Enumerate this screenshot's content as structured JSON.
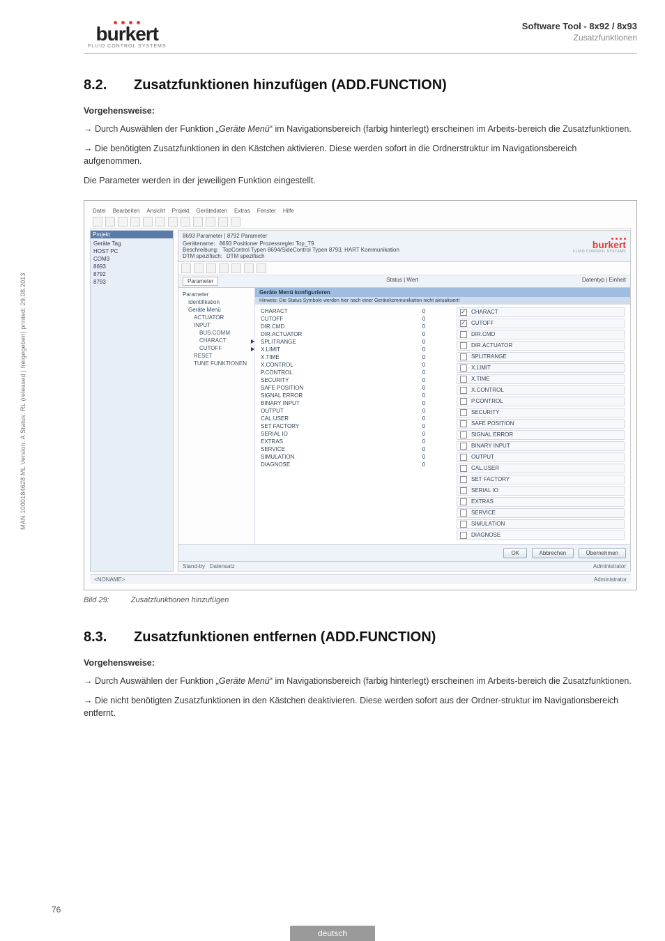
{
  "header": {
    "logo_text": "burkert",
    "logo_sub": "FLUID CONTROL SYSTEMS",
    "title": "Software Tool - 8x92 / 8x93",
    "subtitle": "Zusatzfunktionen"
  },
  "section_8_2": {
    "num": "8.2.",
    "title": "Zusatzfunktionen hinzufügen (ADD.FUNCTION)",
    "vorgehensweise": "Vorgehensweise:",
    "p1_a": "→ Durch Auswählen der Funktion „",
    "p1_em": "Geräte Menü",
    "p1_b": "“ im Navigationsbereich (farbig hinterlegt) erscheinen im Arbeits-bereich die Zusatzfunktionen.",
    "p2": "→ Die benötigten Zusatzfunktionen in den Kästchen aktivieren. Diese werden sofort in die Ordnerstruktur im Navigationsbereich aufgenommen.",
    "p3": "Die Parameter werden in der jeweiligen Funktion eingestellt."
  },
  "screenshot": {
    "menubar": [
      "Datei",
      "Bearbeiten",
      "Ansicht",
      "Projekt",
      "Gerätedaten",
      "Extras",
      "Fenster",
      "Hilfe"
    ],
    "nav": {
      "head": "Projekt",
      "items": [
        "Geräte Tag",
        "HOST PC",
        "COM3",
        "8693",
        "8792",
        "8793"
      ]
    },
    "workhead": {
      "tab": "8693 Parameter  |  8792 Parameter",
      "geraet_lbl": "Gerätename:",
      "geraet_val": "8693 Positioner Prozessregler Top_T9",
      "besch_lbl": "Beschreibung:",
      "besch_val": "TopControl Typen 8694/SideControl Typen 8793, HART Kommunikation",
      "dtm_lbl": "DTM spezifisch:",
      "dtm_val": "DTM spezifisch"
    },
    "inner_logo": "burkert",
    "inner_logo_sub": "FLUID CONTROL SYSTEMS",
    "param_tab": "Parameter",
    "status_lbl": "Status  | Wert",
    "right_lbl": "Datentyp  | Einheit",
    "gm_title": "Geräte Menü konfigurieren",
    "gm_note": "Hinweis: Die Status Symbole werden hier nach einer Gerätekommunikation nicht aktualisiert!",
    "tree": [
      {
        "label": "Parameter",
        "indent": 0
      },
      {
        "label": "Identifikation",
        "indent": 1
      },
      {
        "label": "Geräte Menü",
        "indent": 1,
        "sel": true
      },
      {
        "label": "ACTUATOR",
        "indent": 2
      },
      {
        "label": "INPUT",
        "indent": 2
      },
      {
        "label": "BUS.COMM",
        "indent": 3
      },
      {
        "label": "CHARACT",
        "indent": 3,
        "arrow": true
      },
      {
        "label": "CUTOFF",
        "indent": 3,
        "arrow": true
      },
      {
        "label": "RESET",
        "indent": 2
      },
      {
        "label": "TUNE FUNKTIONEN",
        "indent": 2
      }
    ],
    "func_left": [
      {
        "name": "CHARACT",
        "v": "0"
      },
      {
        "name": "CUTOFF",
        "v": "0"
      },
      {
        "name": "DIR.CMD",
        "v": "0"
      },
      {
        "name": "DIR.ACTUATOR",
        "v": "0"
      },
      {
        "name": "SPLITRANGE",
        "v": "0"
      },
      {
        "name": "X.LIMIT",
        "v": "0"
      },
      {
        "name": "X.TIME",
        "v": "0"
      },
      {
        "name": "X.CONTROL",
        "v": "0"
      },
      {
        "name": "P.CONTROL",
        "v": "0"
      },
      {
        "name": "SECURITY",
        "v": "0"
      },
      {
        "name": "SAFE POSITION",
        "v": "0"
      },
      {
        "name": "SIGNAL ERROR",
        "v": "0"
      },
      {
        "name": "BINARY INPUT",
        "v": "0"
      },
      {
        "name": "OUTPUT",
        "v": "0"
      },
      {
        "name": "CAL.USER",
        "v": "0"
      },
      {
        "name": "SET FACTORY",
        "v": "0"
      },
      {
        "name": "SERIAL IO",
        "v": "0"
      },
      {
        "name": "EXTRAS",
        "v": "0"
      },
      {
        "name": "SERVICE",
        "v": "0"
      },
      {
        "name": "SIMULATION",
        "v": "0"
      },
      {
        "name": "DIAGNOSE",
        "v": "0"
      }
    ],
    "func_right": [
      {
        "name": "CHARACT",
        "chk": true
      },
      {
        "name": "CUTOFF",
        "chk": true
      },
      {
        "name": "DIR.CMD",
        "chk": false
      },
      {
        "name": "DIR.ACTUATOR",
        "chk": false
      },
      {
        "name": "SPLITRANGE",
        "chk": false
      },
      {
        "name": "X.LIMIT",
        "chk": false
      },
      {
        "name": "X.TIME",
        "chk": false
      },
      {
        "name": "X.CONTROL",
        "chk": false
      },
      {
        "name": "P.CONTROL",
        "chk": false
      },
      {
        "name": "SECURITY",
        "chk": false
      },
      {
        "name": "SAFE POSITION",
        "chk": false
      },
      {
        "name": "SIGNAL ERROR",
        "chk": false
      },
      {
        "name": "BINARY INPUT",
        "chk": false
      },
      {
        "name": "OUTPUT",
        "chk": false
      },
      {
        "name": "CAL.USER",
        "chk": false
      },
      {
        "name": "SET FACTORY",
        "chk": false
      },
      {
        "name": "SERIAL IO",
        "chk": false
      },
      {
        "name": "EXTRAS",
        "chk": false
      },
      {
        "name": "SERVICE",
        "chk": false
      },
      {
        "name": "SIMULATION",
        "chk": false
      },
      {
        "name": "DIAGNOSE",
        "chk": false
      }
    ],
    "buttons": {
      "ok": "OK",
      "cancel": "Abbrechen",
      "apply": "Übernehmen"
    },
    "status_left_a": "Stand-by",
    "status_left_b": "Datensatz",
    "status_mid": "Administrator",
    "status_bottom_left": "<NONAME>",
    "status_bottom_right": "Administrator"
  },
  "figcaption": {
    "label": "Bild 29:",
    "text": "Zusatzfunktionen hinzufügen"
  },
  "section_8_3": {
    "num": "8.3.",
    "title": "Zusatzfunktionen entfernen (ADD.FUNCTION)",
    "vorgehensweise": "Vorgehensweise:",
    "p1_a": "→ Durch Auswählen der Funktion „",
    "p1_em": "Geräte Menü",
    "p1_b": "“ im Navigationsbereich (farbig hinterlegt) erscheinen im Arbeits-bereich die Zusatzfunktionen.",
    "p2": "→ Die nicht benötigten Zusatzfunktionen in den Kästchen deaktivieren. Diese werden sofort aus der Ordner-struktur im Navigationsbereich entfernt."
  },
  "sidetext": "MAN 1000184628 ML Version: A Status: RL (released | freigegeben) printed: 29.08.2013",
  "pagenum": "76",
  "langbar": "deutsch"
}
